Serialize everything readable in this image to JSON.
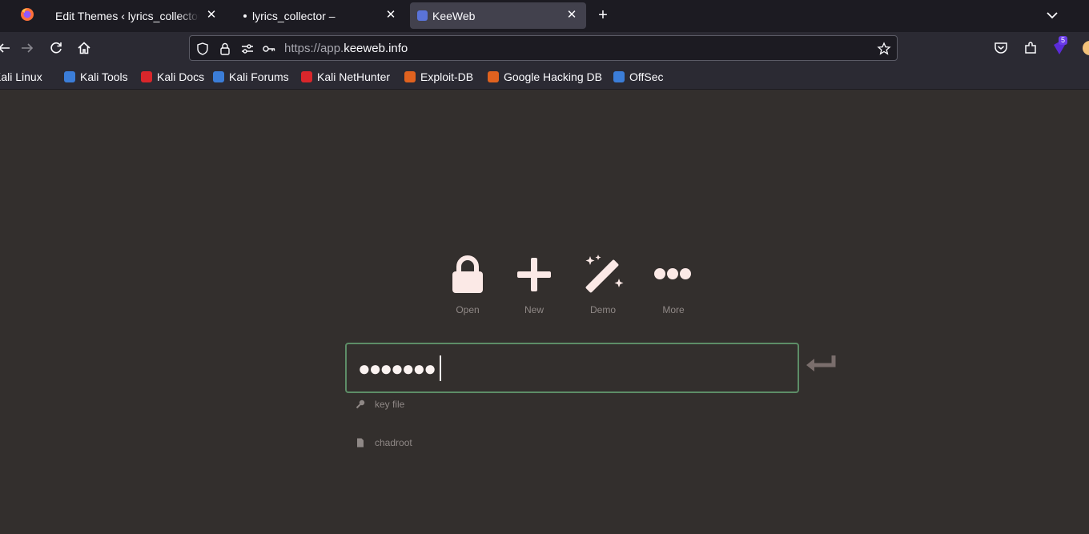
{
  "browser": {
    "tabs": [
      {
        "title": "Edit Themes ‹ lyrics_collector",
        "close": "✕"
      },
      {
        "title": "lyrics_collector –",
        "close": "✕"
      },
      {
        "title": "KeeWeb",
        "close": "✕",
        "active": true
      }
    ],
    "new_tab": "+",
    "url": {
      "prefix": "https://app.",
      "domain": "keeweb.info"
    },
    "extension_badge": "5",
    "bookmarks": [
      {
        "label": "Kali Linux",
        "icon": "kali-dragon-icon",
        "color": "#3b7dd8"
      },
      {
        "label": "Kali Tools",
        "icon": "kali-tools-icon",
        "color": "#3b7dd8"
      },
      {
        "label": "Kali Docs",
        "icon": "kali-docs-icon",
        "color": "#d9262b"
      },
      {
        "label": "Kali Forums",
        "icon": "kali-forums-icon",
        "color": "#3b7dd8"
      },
      {
        "label": "Kali NetHunter",
        "icon": "nethunter-icon",
        "color": "#d9262b"
      },
      {
        "label": "Exploit-DB",
        "icon": "exploit-db-icon",
        "color": "#e0621f"
      },
      {
        "label": "Google Hacking DB",
        "icon": "ghdb-icon",
        "color": "#e0621f"
      },
      {
        "label": "OffSec",
        "icon": "offsec-icon",
        "color": "#3b7dd8"
      }
    ]
  },
  "keeweb": {
    "actions": [
      {
        "label": "Open",
        "icon": "lock-icon"
      },
      {
        "label": "New",
        "icon": "plus-icon"
      },
      {
        "label": "Demo",
        "icon": "magic-wand-icon"
      },
      {
        "label": "More",
        "icon": "more-dots-icon"
      }
    ],
    "password_masked": "●●●●●●●",
    "key_file_label": "key file",
    "last_file_label": "chadroot"
  },
  "colors": {
    "app_bg": "#332f2d",
    "icon": "#fbe9e6",
    "label": "#8f8886",
    "input_border": "#5d8d67",
    "enter_arrow": "#7a6e6c"
  }
}
